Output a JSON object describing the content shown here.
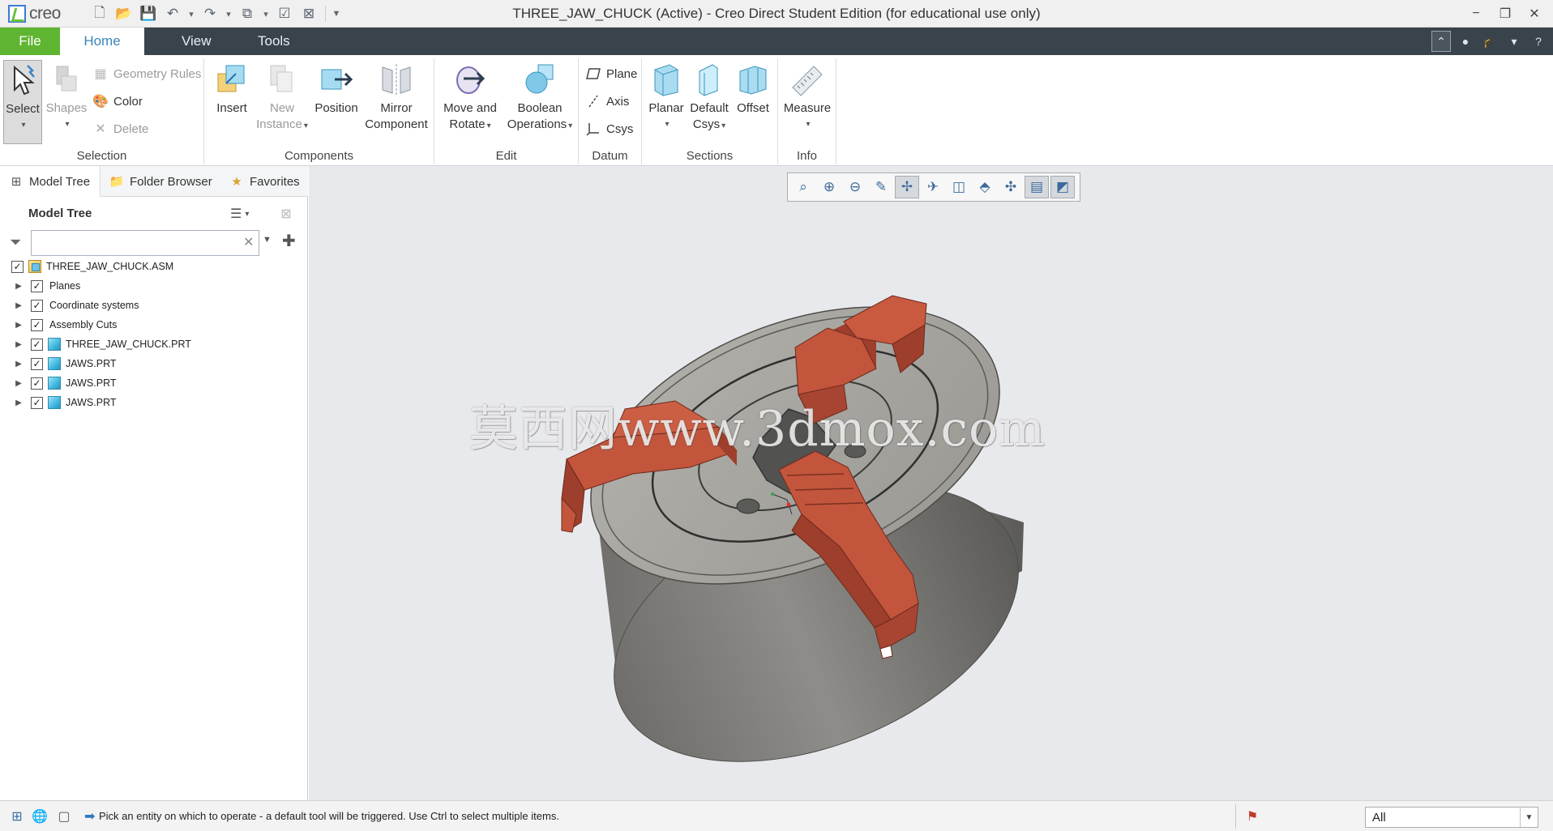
{
  "app": {
    "logo_text": "creo",
    "window_title": "THREE_JAW_CHUCK (Active) - Creo Direct Student Edition (for educational use only)"
  },
  "quick_access": [
    "new-file-icon",
    "open-folder-icon",
    "save-icon",
    "undo-icon",
    "redo-icon",
    "regenerate-icon",
    "checkmark-window-icon",
    "close-window-icon",
    "customize-dropdown-icon"
  ],
  "window_controls": {
    "minimize": "−",
    "restore": "❐",
    "close": "✕"
  },
  "tabs": {
    "file": "File",
    "home": "Home",
    "view": "View",
    "tools": "Tools"
  },
  "ribbon": {
    "selection": {
      "label": "Selection",
      "select": "Select",
      "shapes": "Shapes",
      "geometry_rules": "Geometry Rules",
      "color": "Color",
      "delete": "Delete"
    },
    "components": {
      "label": "Components",
      "insert": "Insert",
      "new_instance_1": "New",
      "new_instance_2": "Instance",
      "position": "Position",
      "mirror_1": "Mirror",
      "mirror_2": "Component"
    },
    "edit": {
      "label": "Edit",
      "move_1": "Move and",
      "move_2": "Rotate",
      "boolean_1": "Boolean",
      "boolean_2": "Operations"
    },
    "datum": {
      "label": "Datum",
      "plane": "Plane",
      "axis": "Axis",
      "csys": "Csys"
    },
    "sections": {
      "label": "Sections",
      "planar": "Planar",
      "default_1": "Default",
      "default_2": "Csys",
      "offset": "Offset"
    },
    "info": {
      "label": "Info",
      "measure": "Measure"
    }
  },
  "navigator": {
    "tabs": {
      "model_tree": "Model Tree",
      "folder_browser": "Folder Browser",
      "favorites": "Favorites"
    },
    "tree_title": "Model Tree",
    "filter_value": "",
    "items": [
      {
        "label": "THREE_JAW_CHUCK.ASM",
        "kind": "asm"
      },
      {
        "label": "Planes",
        "kind": "folder"
      },
      {
        "label": "Coordinate systems",
        "kind": "folder"
      },
      {
        "label": "Assembly Cuts",
        "kind": "folder"
      },
      {
        "label": "THREE_JAW_CHUCK.PRT",
        "kind": "prt"
      },
      {
        "label": "JAWS.PRT",
        "kind": "prt"
      },
      {
        "label": "JAWS.PRT",
        "kind": "prt"
      },
      {
        "label": "JAWS.PRT",
        "kind": "prt"
      }
    ]
  },
  "graphics": {
    "watermark": "莫西网www.3dmox.com",
    "view_toolbar": [
      "refit-icon",
      "zoom-in-icon",
      "zoom-out-icon",
      "repaint-icon",
      "spin-center-icon",
      "saved-orientations-icon",
      "display-style-icon",
      "planes-display-icon",
      "datum-display-icon",
      "annotations-display-icon",
      "named-views-icon"
    ],
    "colors": {
      "chuck_body": "#8b8a86",
      "chuck_face": "#a9a7a2",
      "jaw": "#c2553c",
      "background": "#e8e9ed"
    }
  },
  "status": {
    "message": "Pick an entity on which to operate - a default tool will be triggered. Use Ctrl to select multiple items.",
    "filter": "All"
  }
}
